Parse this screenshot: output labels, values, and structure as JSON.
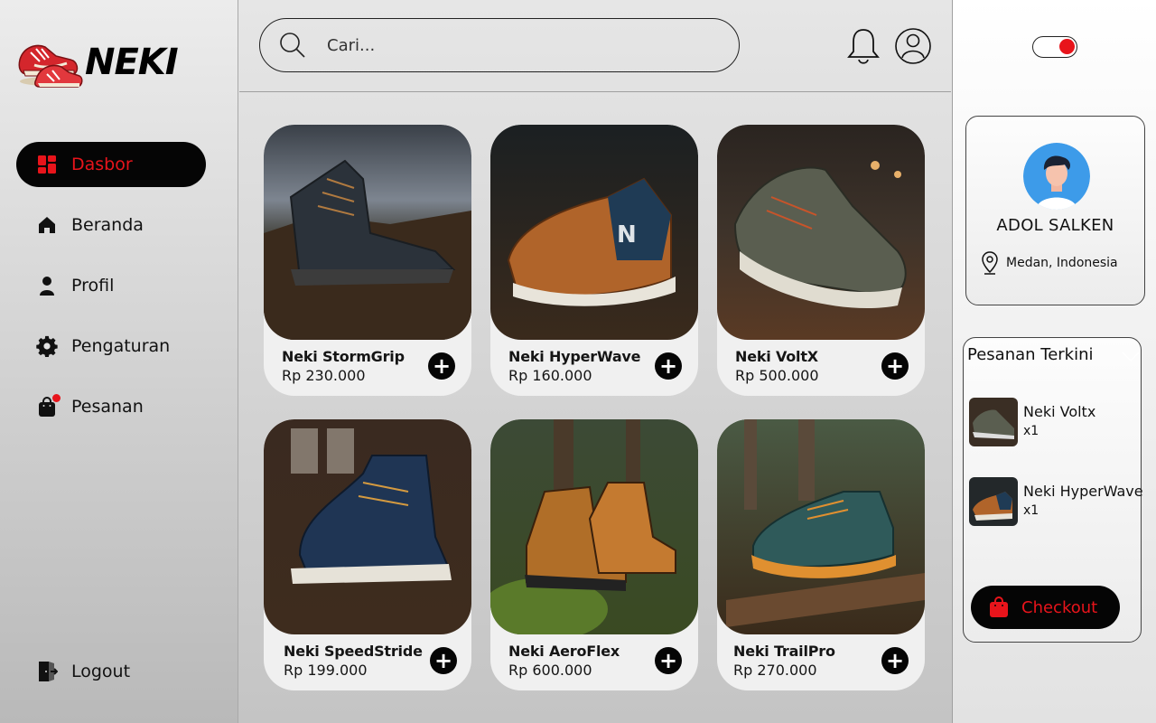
{
  "brand": {
    "name": "NEKI"
  },
  "colors": {
    "accent": "#e8141b",
    "dark": "#050505",
    "panel": "#f0f0f0"
  },
  "sidebar": {
    "items": [
      {
        "label": "Dasbor",
        "icon": "dashboard-icon",
        "active": true
      },
      {
        "label": "Beranda",
        "icon": "home-icon",
        "active": false
      },
      {
        "label": "Profil",
        "icon": "user-icon",
        "active": false
      },
      {
        "label": "Pengaturan",
        "icon": "gear-icon",
        "active": false
      },
      {
        "label": "Pesanan",
        "icon": "shopping-bag-icon",
        "active": false,
        "badge_dot": true
      }
    ],
    "logout_label": "Logout"
  },
  "header": {
    "search": {
      "placeholder": "Cari..."
    },
    "icons": [
      "bell-icon",
      "account-icon"
    ]
  },
  "products": [
    {
      "name": "Neki StormGrip",
      "price": "Rp 230.000"
    },
    {
      "name": "Neki HyperWave",
      "price": "Rp 160.000"
    },
    {
      "name": "Neki VoltX",
      "price": "Rp 500.000"
    },
    {
      "name": "Neki SpeedStride",
      "price": "Rp 199.000"
    },
    {
      "name": "Neki AeroFlex",
      "price": "Rp 600.000"
    },
    {
      "name": "Neki TrailPro",
      "price": "Rp 270.000"
    }
  ],
  "profile": {
    "name": "ADOL SALKEN",
    "location": "Medan, Indonesia"
  },
  "theme_toggle": {
    "on": true
  },
  "orders": {
    "title": "Pesanan Terkini",
    "items": [
      {
        "name": "Neki Voltx",
        "qty": "x1"
      },
      {
        "name": "Neki HyperWave",
        "qty": "x1"
      }
    ],
    "checkout_label": "Checkout"
  }
}
